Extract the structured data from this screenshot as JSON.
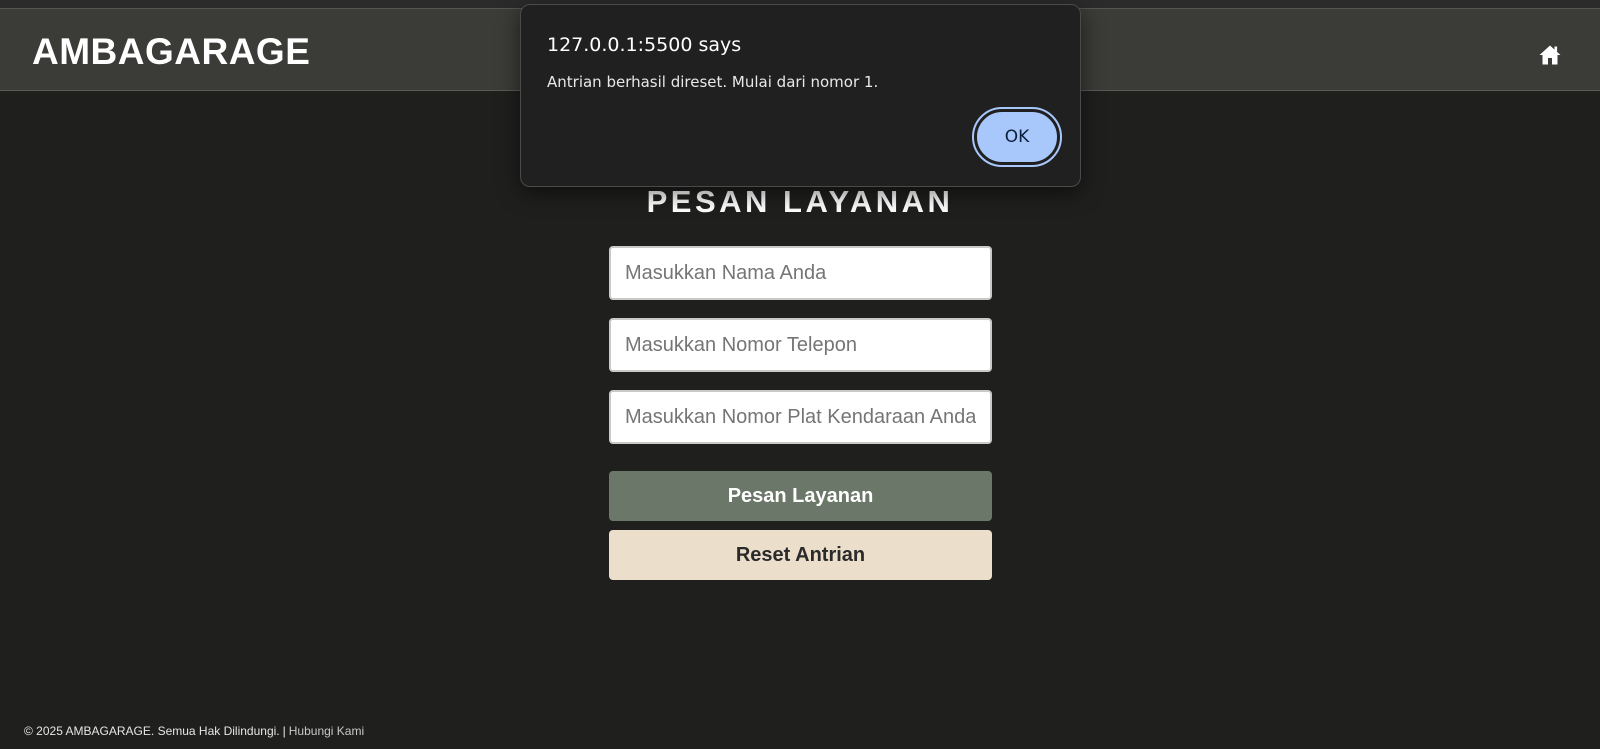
{
  "header": {
    "brand": "AMBAGARAGE",
    "home_icon": "home-icon"
  },
  "main": {
    "title": "PESAN LAYANAN",
    "fields": {
      "name_placeholder": "Masukkan Nama Anda",
      "name_value": "",
      "phone_placeholder": "Masukkan Nomor Telepon",
      "phone_value": "",
      "plate_placeholder": "Masukkan Nomor Plat Kendaraan Anda",
      "plate_value": ""
    },
    "submit_label": "Pesan Layanan",
    "reset_label": "Reset Antrian"
  },
  "footer": {
    "copyright": "© 2025 AMBAGARAGE. Semua Hak Dilindungi.",
    "separator": "|",
    "contact_link": "Hubungi Kami"
  },
  "dialog": {
    "origin": "127.0.0.1:5500 says",
    "message": "Antrian berhasil direset. Mulai dari nomor 1.",
    "ok_label": "OK"
  },
  "colors": {
    "page_bg": "#1f201e",
    "header_bg": "#3b3c38",
    "primary_button": "#6b7768",
    "reset_button": "#ebdecb",
    "dialog_bg": "#202020",
    "dialog_ok": "#a8c7fa"
  }
}
